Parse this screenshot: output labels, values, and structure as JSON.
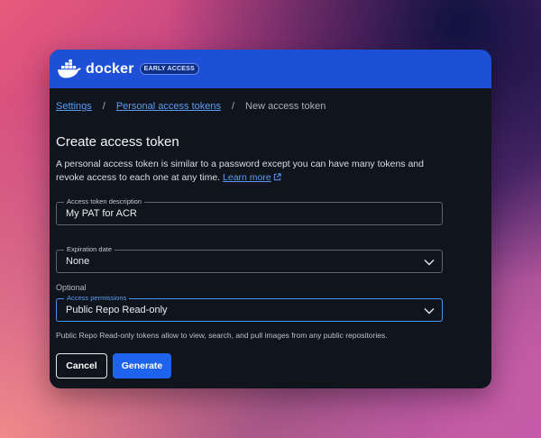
{
  "header": {
    "logo_text": "docker",
    "badge": "EARLY ACCESS",
    "brand_color": "#1d4fd7"
  },
  "breadcrumb": {
    "items": [
      "Settings",
      "Personal access tokens"
    ],
    "separator": "/",
    "current": "New access token"
  },
  "page": {
    "title": "Create access token",
    "description": "A personal access token is similar to a password except you can have many tokens and revoke access to each one at any time.",
    "learn_more": "Learn more"
  },
  "form": {
    "description_field": {
      "label": "Access token description",
      "value": "My PAT for ACR"
    },
    "expiration_field": {
      "label": "Expiration date",
      "value": "None"
    },
    "optional_text": "Optional",
    "permissions_field": {
      "label": "Access permissions",
      "value": "Public Repo Read-only"
    },
    "helper_text": "Public Repo Read-only tokens allow to view, search, and pull images from any public repositories."
  },
  "actions": {
    "cancel_label": "Cancel",
    "generate_label": "Generate",
    "primary_color": "#1d63ed"
  },
  "icons": {
    "logo": "docker-whale-icon",
    "external": "external-link-icon",
    "dropdown": "chevron-down-icon"
  }
}
